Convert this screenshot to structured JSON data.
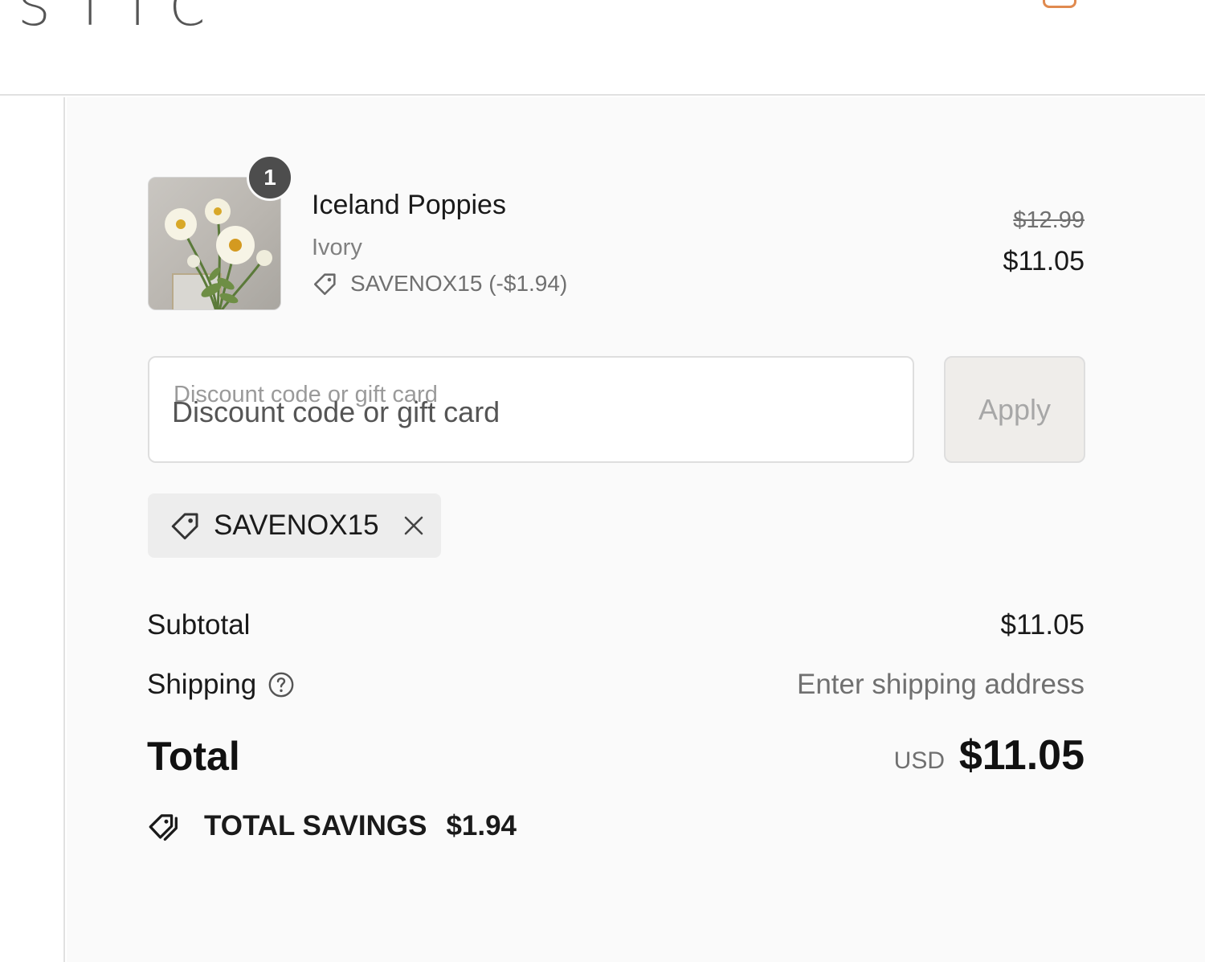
{
  "header": {
    "logo_text": "STIC",
    "cart_icon": "shopping-bag-icon"
  },
  "line_item": {
    "quantity": "1",
    "name": "Iceland Poppies",
    "variant": "Ivory",
    "discount_text": "SAVENOX15 (-$1.94)",
    "original_price": "$12.99",
    "price": "$11.05",
    "image_subject": "white poppy flowers in vase"
  },
  "discount_form": {
    "floating_label": "Discount code or gift card",
    "placeholder": "Discount code or gift card",
    "value": "",
    "apply_label": "Apply"
  },
  "applied_code": {
    "label": "SAVENOX15",
    "icon": "tag-icon",
    "remove_icon": "close-icon"
  },
  "totals": {
    "subtotal_label": "Subtotal",
    "subtotal_value": "$11.05",
    "shipping_label": "Shipping",
    "shipping_value": "Enter shipping address",
    "total_label": "Total",
    "currency": "USD",
    "total_value": "$11.05",
    "savings_label": "TOTAL SAVINGS",
    "savings_value": "$1.94"
  },
  "colors": {
    "summary_background": "#fafafa",
    "badge": "#4d4d4d",
    "muted_text": "#707070",
    "apply_button": "#efedea",
    "cart_accent": "#e08a4f"
  }
}
